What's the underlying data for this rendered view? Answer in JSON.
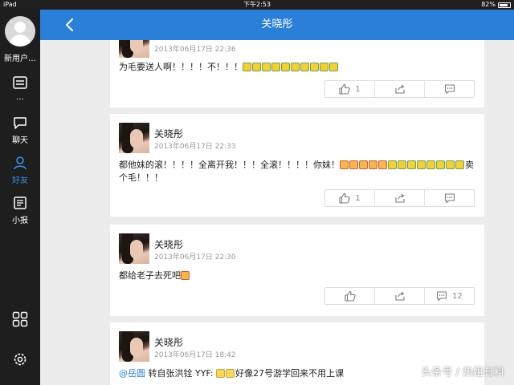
{
  "status_bar": {
    "device": "iPad",
    "time": "下午2:53",
    "battery": "82%",
    "battery_level": 0.82
  },
  "sidebar": {
    "user_name": "新用户…",
    "items": [
      {
        "label": "…",
        "icon": "list-icon"
      },
      {
        "label": "聊天",
        "icon": "chat-icon"
      },
      {
        "label": "好友",
        "icon": "friends-icon",
        "active": true
      },
      {
        "label": "小报",
        "icon": "news-icon"
      }
    ],
    "bottom_icons": [
      "apps-grid-icon",
      "settings-gear-icon"
    ]
  },
  "header": {
    "title": "关晓彤",
    "back_icon": "chevron-left-icon"
  },
  "posts": [
    {
      "name": "",
      "time": "2013年06月17日 22:36",
      "content": "为毛要送人啊！！！！不！！！",
      "emoji_after": 10,
      "emoji_type": "cry",
      "like_count": "1",
      "share_count": "",
      "comment_count": ""
    },
    {
      "name": "关晓彤",
      "time": "2013年06月17日 22:33",
      "content": "都他妹的滚！！！！全离开我！！！全滚！！！！你妹！",
      "content_tail": "卖个毛！！！",
      "like_count": "1",
      "share_count": "",
      "comment_count": ""
    },
    {
      "name": "关晓彤",
      "time": "2013年06月17日 22:30",
      "content": "都给老子去死吧",
      "like_count": "",
      "share_count": "",
      "comment_count": "12"
    },
    {
      "name": "关晓彤",
      "time": "2013年06月17日 18:42",
      "mention": "@岳圆",
      "content": " 转自张洪铨 YYF: ",
      "content_tail": "好像27号游学回来不用上课"
    }
  ],
  "watermark": "头条号 / 热姐有料",
  "colors": {
    "accent": "#2b7fd6",
    "sidebar_bg": "#1e1e1e",
    "feed_bg": "#ececec"
  }
}
